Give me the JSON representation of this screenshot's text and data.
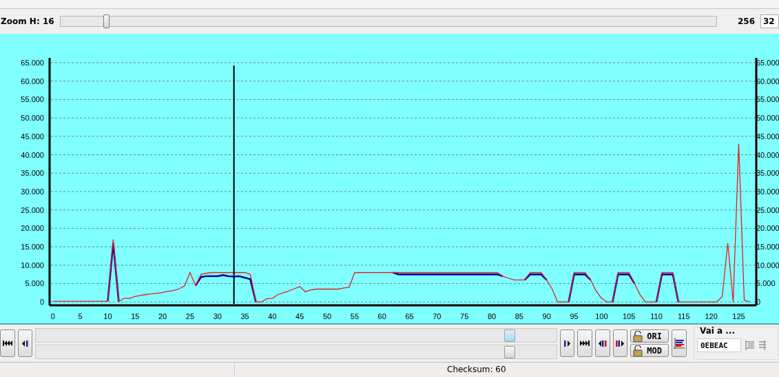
{
  "zoom": {
    "label": "Zoom H: 16",
    "level": 0.07,
    "max": "256",
    "value": "32"
  },
  "chart": {
    "chart_data": {
      "type": "line",
      "x": [
        0,
        1,
        2,
        3,
        4,
        5,
        6,
        7,
        8,
        9,
        10,
        11,
        12,
        13,
        14,
        15,
        16,
        17,
        18,
        19,
        20,
        21,
        22,
        23,
        24,
        25,
        26,
        27,
        28,
        29,
        30,
        31,
        32,
        33,
        34,
        35,
        36,
        37,
        38,
        39,
        40,
        41,
        42,
        43,
        44,
        45,
        46,
        47,
        48,
        49,
        50,
        51,
        52,
        53,
        54,
        55,
        56,
        57,
        58,
        59,
        60,
        61,
        62,
        63,
        64,
        65,
        66,
        67,
        68,
        69,
        70,
        71,
        72,
        73,
        74,
        75,
        76,
        77,
        78,
        79,
        80,
        81,
        82,
        83,
        84,
        85,
        86,
        87,
        88,
        89,
        90,
        91,
        92,
        93,
        94,
        95,
        96,
        97,
        98,
        99,
        100,
        101,
        102,
        103,
        104,
        105,
        106,
        107,
        108,
        109,
        110,
        111,
        112,
        113,
        114,
        115,
        116,
        117,
        118,
        119,
        120,
        121,
        122,
        123,
        124,
        125,
        126,
        127
      ],
      "xlim": [
        -0.6,
        128.2
      ],
      "ylim": [
        -900,
        66300
      ],
      "grid": true,
      "xticks": [
        0,
        5,
        10,
        15,
        20,
        25,
        30,
        35,
        40,
        45,
        50,
        55,
        60,
        65,
        70,
        75,
        80,
        85,
        90,
        95,
        100,
        105,
        110,
        115,
        120,
        125
      ],
      "yticks": [
        {
          "value": 0,
          "label": "0"
        },
        {
          "value": 5000,
          "label": "5.000"
        },
        {
          "value": 10000,
          "label": "10.000"
        },
        {
          "value": 15000,
          "label": "15.000"
        },
        {
          "value": 20000,
          "label": "20.000"
        },
        {
          "value": 25000,
          "label": "25.000"
        },
        {
          "value": 30000,
          "label": "30.000"
        },
        {
          "value": 35000,
          "label": "35.000"
        },
        {
          "value": 40000,
          "label": "40.000"
        },
        {
          "value": 45000,
          "label": "45.000"
        },
        {
          "value": 50000,
          "label": "50.000"
        },
        {
          "value": 55000,
          "label": "55.000"
        },
        {
          "value": 60000,
          "label": "60.000"
        },
        {
          "value": 65000,
          "label": "65.000"
        }
      ],
      "series": [
        {
          "color": "#0000a0",
          "values": [
            null,
            null,
            null,
            null,
            null,
            null,
            null,
            null,
            null,
            null,
            200,
            16000,
            100,
            null,
            null,
            null,
            null,
            null,
            null,
            null,
            null,
            null,
            null,
            null,
            null,
            null,
            4500,
            6800,
            7000,
            7000,
            7000,
            7300,
            7000,
            6900,
            7000,
            6600,
            6200,
            0,
            null,
            null,
            null,
            null,
            null,
            null,
            null,
            null,
            null,
            null,
            null,
            null,
            null,
            null,
            null,
            null,
            null,
            null,
            null,
            null,
            null,
            null,
            null,
            null,
            8000,
            7500,
            7500,
            7500,
            7500,
            7500,
            7500,
            7500,
            7500,
            7500,
            7500,
            7500,
            7500,
            7500,
            7500,
            7500,
            7500,
            7500,
            7500,
            7500,
            7000,
            null,
            null,
            null,
            6000,
            7500,
            7500,
            7500,
            6000,
            null,
            null,
            null,
            0,
            7500,
            7500,
            7500,
            6000,
            null,
            null,
            null,
            0,
            7500,
            7500,
            7500,
            5000,
            null,
            null,
            null,
            0,
            7500,
            7500,
            7500,
            0,
            null,
            null,
            null,
            null,
            null,
            null,
            null,
            null,
            null,
            null,
            null,
            null,
            null
          ]
        },
        {
          "color": "#e02020",
          "values": [
            200,
            200,
            200,
            200,
            200,
            200,
            200,
            200,
            200,
            200,
            200,
            17000,
            100,
            1000,
            1000,
            1500,
            1800,
            2000,
            2200,
            2400,
            2600,
            2900,
            3100,
            3600,
            4400,
            8000,
            4500,
            7500,
            7800,
            8000,
            8000,
            8000,
            8000,
            8000,
            8000,
            8000,
            7500,
            0,
            0,
            900,
            1000,
            2000,
            2500,
            3000,
            3600,
            4200,
            2800,
            3300,
            3500,
            3500,
            3500,
            3500,
            3500,
            3800,
            4000,
            8000,
            8000,
            8000,
            8000,
            8000,
            8000,
            8000,
            8000,
            8000,
            8000,
            8000,
            8000,
            8000,
            8000,
            8000,
            8000,
            8000,
            8000,
            8000,
            8000,
            8000,
            8000,
            8000,
            8000,
            8000,
            8000,
            8000,
            7000,
            6500,
            6000,
            6000,
            6000,
            8000,
            8000,
            8000,
            6000,
            3500,
            0,
            0,
            0,
            8000,
            8000,
            8000,
            6000,
            3000,
            1000,
            0,
            0,
            8000,
            8000,
            8000,
            5000,
            2000,
            0,
            0,
            0,
            8000,
            8000,
            8000,
            0,
            0,
            0,
            0,
            0,
            0,
            0,
            0,
            1500,
            16000,
            0,
            43000,
            500,
            0
          ]
        }
      ],
      "ref_lines": [
        {
          "axis": "x",
          "value": 33
        }
      ]
    }
  },
  "nav_left": [
    {
      "kind": "first"
    },
    {
      "kind": "prev"
    }
  ],
  "nav_right": [
    {
      "kind": "next"
    },
    {
      "kind": "last"
    },
    {
      "kind": "diff_prev"
    },
    {
      "kind": "diff_next"
    }
  ],
  "lock_buttons": [
    {
      "label": "ORI"
    },
    {
      "label": "MOD"
    }
  ],
  "goto": {
    "title": "Vai a ...",
    "value": "0EBEAC"
  },
  "status_bar": {
    "checksum": "Checksum: 60"
  }
}
